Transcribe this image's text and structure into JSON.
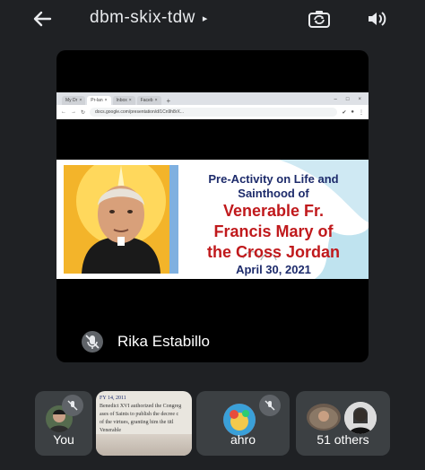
{
  "header": {
    "meeting_code": "dbm-skix-tdw",
    "caret": "▸"
  },
  "browser": {
    "tabs": [
      "My Dr",
      "Pr-lan",
      "Inbox",
      "Faceb"
    ],
    "url": "docs.google.com/presentation/d/1Cn9h8rX..."
  },
  "slide": {
    "line1": "Pre-Activity on Life and",
    "line2": "Sainthood of",
    "title_line1": "Venerable Fr.",
    "title_line2": "Francis Mary of",
    "title_line3": "the Cross Jordan",
    "date": "April 30, 2021"
  },
  "presenter": {
    "name": "Rika Estabillo"
  },
  "participants": {
    "you_label": "You",
    "share_lines": [
      "FY 14, 2011",
      "Benedict XVI authorized the Congreg",
      "ases of Saints to publish the decree c",
      "of the virtues, granting him the titl",
      "Venerable"
    ],
    "ahro_label": "ahro",
    "others_label": "51 others"
  },
  "colors": {
    "background": "#1f2124",
    "tile": "#3c4043",
    "slide_blue": "#1d2b6b",
    "slide_red": "#c0191c"
  }
}
